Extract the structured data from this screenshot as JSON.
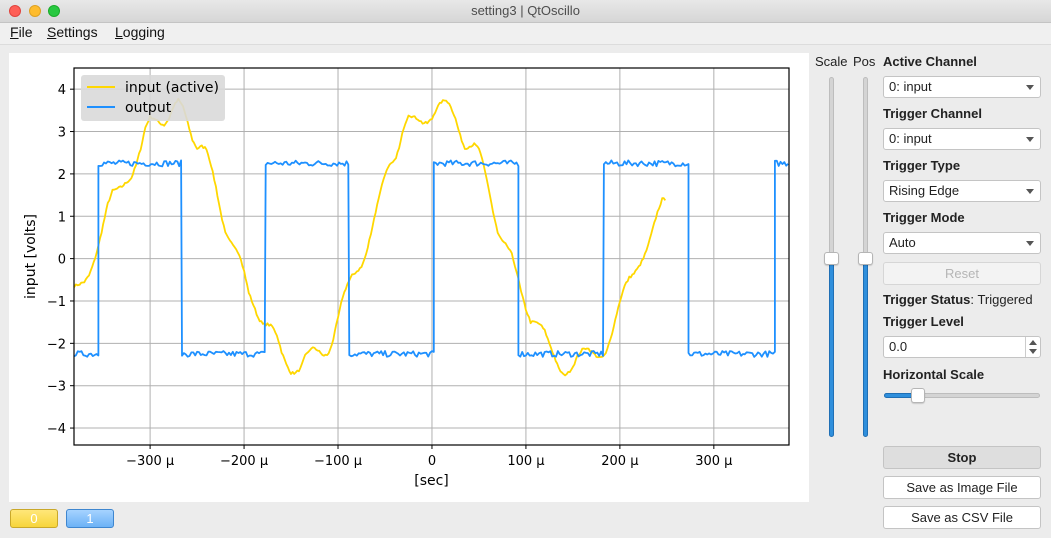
{
  "window": {
    "title": "setting3 | QtOscillo"
  },
  "menu": [
    {
      "mnemonic": "F",
      "rest": "ile"
    },
    {
      "mnemonic": "S",
      "rest": "ettings"
    },
    {
      "mnemonic": "L",
      "rest": "ogging"
    }
  ],
  "channel_buttons": [
    {
      "label": "0",
      "color": "#f7d53b"
    },
    {
      "label": "1",
      "color": "#6cb2f6"
    }
  ],
  "controls": {
    "scale_label": "Scale",
    "pos_label": "Pos",
    "scale_value": 0.5,
    "pos_value": 0.5,
    "active_channel_label": "Active Channel",
    "active_channel_value": "0: input",
    "trigger_channel_label": "Trigger Channel",
    "trigger_channel_value": "0: input",
    "trigger_type_label": "Trigger Type",
    "trigger_type_value": "Rising Edge",
    "trigger_mode_label": "Trigger Mode",
    "trigger_mode_value": "Auto",
    "reset_label": "Reset",
    "trigger_status_label": "Trigger Status",
    "trigger_status_sep": ":",
    "trigger_status_value": "Triggered",
    "trigger_level_label": "Trigger Level",
    "trigger_level_value": "0.0",
    "horizontal_scale_label": "Horizontal Scale",
    "horizontal_scale_value": 0.18,
    "stop_label": "Stop",
    "save_image_label": "Save as Image File",
    "save_csv_label": "Save as CSV File"
  },
  "chart_data": {
    "type": "line",
    "title": "",
    "xlabel": "[sec]",
    "ylabel": "input [volts]",
    "xlim": [
      -381,
      380
    ],
    "ylim": [
      -4.4,
      4.5
    ],
    "x_unit": "µs",
    "grid": true,
    "legend_position": "top-left",
    "xticks": [
      -300,
      -200,
      -100,
      0,
      100,
      200,
      300
    ],
    "xtick_labels": [
      "−300 µ",
      "−200 µ",
      "−100 µ",
      "0",
      "100 µ",
      "200 µ",
      "300 µ"
    ],
    "yticks": [
      4,
      3,
      2,
      1,
      0,
      -1,
      -2,
      -3,
      -4
    ],
    "ytick_labels": [
      "4",
      "3",
      "2",
      "1",
      "0",
      "−1",
      "−2",
      "−3",
      "−4"
    ],
    "series": [
      {
        "name": "input (active)",
        "color": "#ffd700",
        "x": [
          -381,
          -375,
          -370,
          -365,
          -360,
          -355,
          -350,
          -345,
          -340,
          -335,
          -330,
          -325,
          -320,
          -315,
          -310,
          -305,
          -300,
          -295,
          -290,
          -285,
          -280,
          -275,
          -270,
          -265,
          -260,
          -255,
          -250,
          -245,
          -240,
          -235,
          -230,
          -225,
          -220,
          -215,
          -210,
          -205,
          -200,
          -195,
          -190,
          -185,
          -180,
          -175,
          -170,
          -165,
          -160,
          -155,
          -150,
          -145,
          -140,
          -135,
          -130,
          -125,
          -120,
          -115,
          -110,
          -105,
          -100,
          -95,
          -90,
          -85,
          -80,
          -75,
          -70,
          -65,
          -60,
          -55,
          -50,
          -45,
          -40,
          -35,
          -30,
          -25,
          -20,
          -15,
          -10,
          -5,
          0,
          5,
          10,
          15,
          20,
          25,
          30,
          35,
          40,
          45,
          50,
          55,
          60,
          65,
          70,
          75,
          80,
          85,
          90,
          95,
          100,
          105,
          110,
          115,
          120,
          125,
          130,
          135,
          140,
          145,
          150,
          155,
          160,
          165,
          170,
          175,
          180,
          185,
          190,
          195,
          200,
          205,
          210,
          215,
          220,
          225,
          230,
          235,
          240,
          245,
          250,
          255,
          260,
          265,
          270,
          275,
          280,
          285,
          290,
          295,
          300,
          305,
          310,
          315,
          320,
          325,
          330,
          335,
          340,
          345,
          350,
          355,
          360,
          365,
          370,
          375,
          380
        ],
        "y": [
          -0.65,
          -0.6,
          -0.55,
          -0.4,
          -0.1,
          0.3,
          0.8,
          1.3,
          1.6,
          1.65,
          1.7,
          1.8,
          1.9,
          2.2,
          2.6,
          3.1,
          3.35,
          3.3,
          3.2,
          3.15,
          3.3,
          3.6,
          3.75,
          3.6,
          3.2,
          2.8,
          2.6,
          2.65,
          2.6,
          2.2,
          1.7,
          1.1,
          0.6,
          0.4,
          0.3,
          0.1,
          -0.3,
          -0.8,
          -1.1,
          -1.4,
          -1.55,
          -1.55,
          -1.6,
          -1.8,
          -2.2,
          -2.5,
          -2.7,
          -2.7,
          -2.6,
          -2.3,
          -2.15,
          -2.1,
          -2.2,
          -2.3,
          -2.25,
          -1.9,
          -1.4,
          -0.9,
          -0.6,
          -0.4,
          -0.3,
          -0.2,
          0.1,
          0.6,
          1.1,
          1.6,
          2.0,
          2.2,
          2.3,
          2.6,
          3.1,
          3.4,
          3.35,
          3.3,
          3.2,
          3.2,
          3.3,
          3.55,
          3.7,
          3.75,
          3.6,
          3.3,
          2.9,
          2.6,
          2.65,
          2.7,
          2.6,
          2.2,
          1.7,
          1.1,
          0.6,
          0.4,
          0.3,
          0.1,
          -0.3,
          -0.8,
          -1.2,
          -1.5,
          -1.5,
          -1.55,
          -1.7,
          -2.0,
          -2.3,
          -2.6,
          -2.75,
          -2.7,
          -2.55,
          -2.3,
          -2.15,
          -2.1,
          -2.2,
          -2.3,
          -2.35,
          -2.25,
          -1.9,
          -1.45,
          -1.0,
          -0.65,
          -0.45,
          -0.35,
          -0.2,
          0.0,
          0.3,
          0.7,
          1.1,
          1.4
        ],
        "y_comment": "input trace is plotted via interpolation; arrays truncated to rendered span"
      },
      {
        "name": "output",
        "color": "#1e90ff",
        "segments": [
          {
            "from": -381,
            "to": -355,
            "level": -2.25
          },
          {
            "from": -355,
            "to": -266,
            "level": 2.25
          },
          {
            "from": -266,
            "to": -177,
            "level": -2.25
          },
          {
            "from": -177,
            "to": -88,
            "level": 2.25
          },
          {
            "from": -88,
            "to": 2,
            "level": -2.25
          },
          {
            "from": 2,
            "to": 92,
            "level": 2.25
          },
          {
            "from": 92,
            "to": 183,
            "level": -2.25
          },
          {
            "from": 183,
            "to": 273,
            "level": 2.25
          },
          {
            "from": 273,
            "to": 365,
            "level": -2.25
          },
          {
            "from": 365,
            "to": 380,
            "level": 2.25
          }
        ]
      }
    ]
  }
}
